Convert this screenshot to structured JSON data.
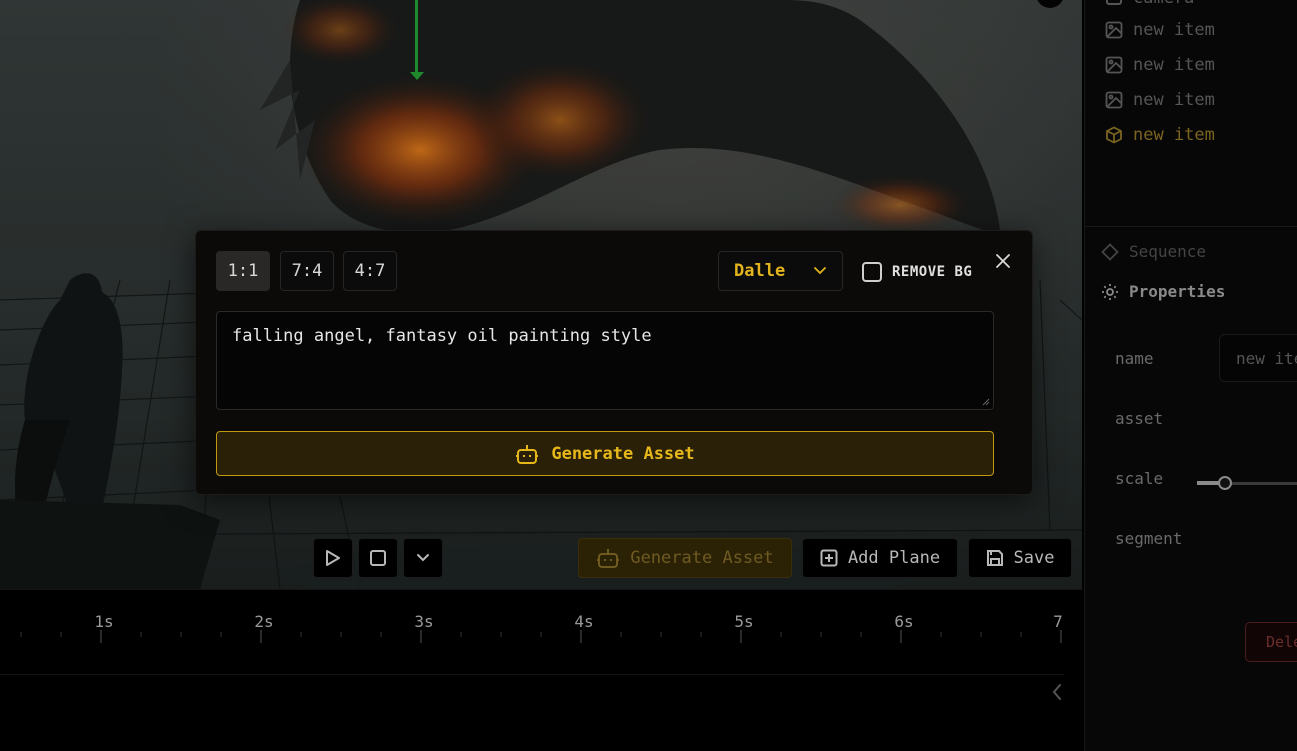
{
  "modal": {
    "ratios": [
      {
        "label": "1:1",
        "selected": true
      },
      {
        "label": "7:4",
        "selected": false
      },
      {
        "label": "4:7",
        "selected": false
      }
    ],
    "model_select": {
      "value": "Dalle"
    },
    "remove_bg": {
      "label": "REMOVE BG",
      "checked": false
    },
    "prompt": "falling angel, fantasy oil painting style",
    "generate_label": "Generate Asset",
    "close_icon": "close-icon"
  },
  "viewport_toolbar": {
    "play_icon": "play-icon",
    "stop_icon": "stop-icon",
    "dropdown_icon": "chevron-down-icon",
    "generate_label": "Generate Asset",
    "add_plane_label": "Add Plane",
    "save_label": "Save"
  },
  "timeline": {
    "ticks": [
      "1s",
      "2s",
      "3s",
      "4s",
      "5s",
      "6s",
      "7"
    ]
  },
  "scene_tree": {
    "items": [
      {
        "label": "camera",
        "icon": "camera-icon",
        "active": false
      },
      {
        "label": "new item",
        "icon": "image-icon",
        "active": false
      },
      {
        "label": "new item",
        "icon": "image-icon",
        "active": false
      },
      {
        "label": "new item",
        "icon": "image-icon",
        "active": false
      },
      {
        "label": "new item",
        "icon": "cube-icon",
        "active": true
      }
    ]
  },
  "properties_panel": {
    "sequence_label": "Sequence",
    "properties_label": "Properties",
    "fields": {
      "name_label": "name",
      "name_value": "new item",
      "asset_label": "asset",
      "scale_label": "scale",
      "segment_label": "segment"
    },
    "delete_label": "Delete"
  },
  "colors": {
    "accent": "#e5b71a",
    "background": "#000000",
    "danger": "#6a2c2c"
  }
}
